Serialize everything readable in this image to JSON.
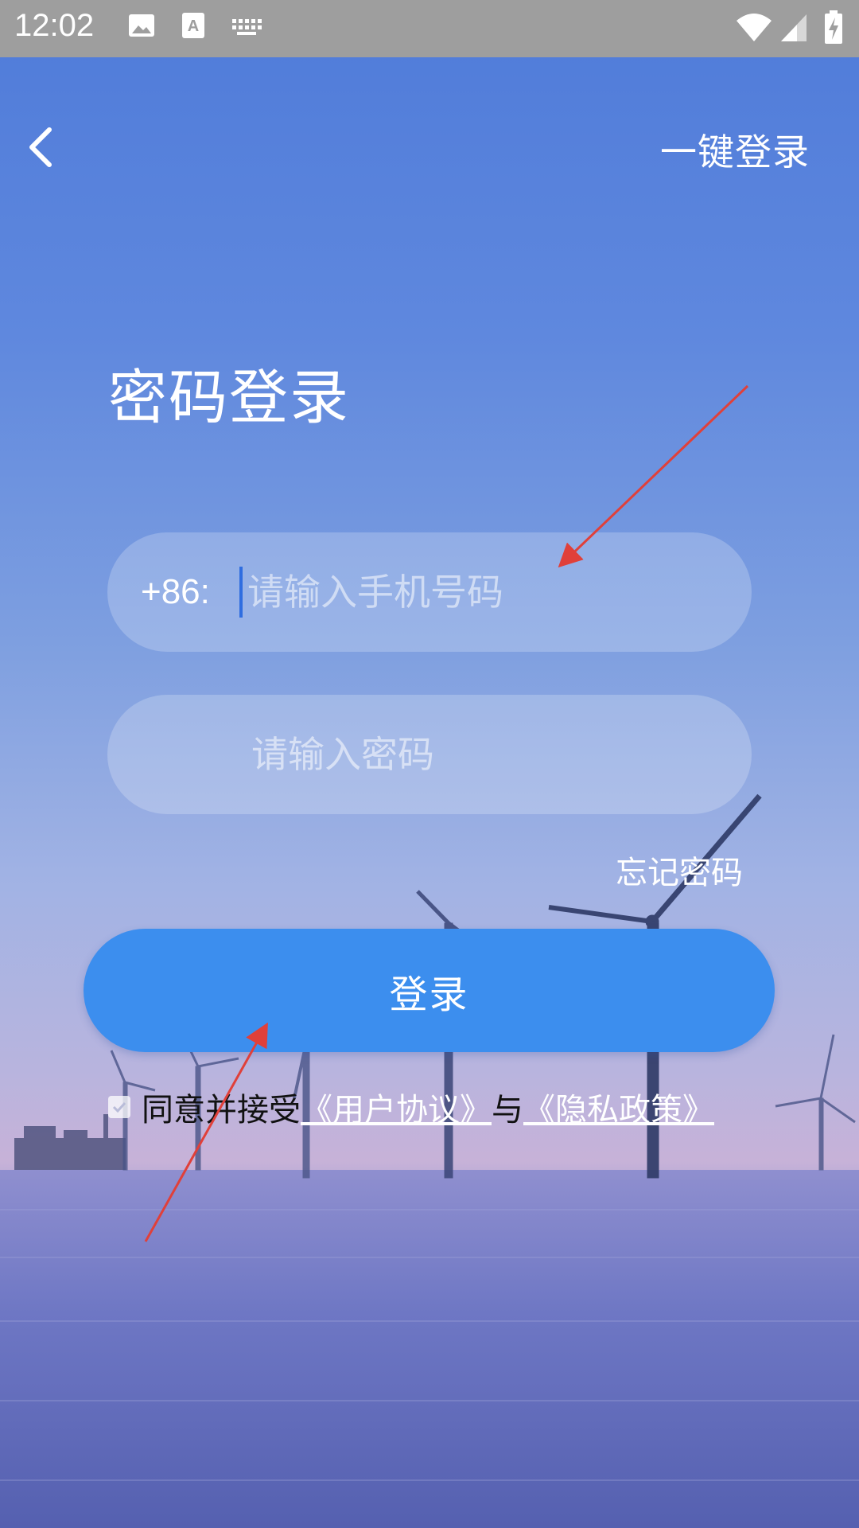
{
  "status_bar": {
    "time": "12:02",
    "icons": [
      "image-icon",
      "text-a-icon",
      "keyboard-icon",
      "wifi-icon",
      "signal-icon",
      "battery-charging-icon"
    ]
  },
  "header": {
    "back_icon": "chevron-left-icon",
    "one_key_login": "一键登录"
  },
  "title": "密码登录",
  "phone": {
    "prefix": "+86:",
    "placeholder": "请输入手机号码",
    "value": ""
  },
  "password": {
    "placeholder": "请输入密码",
    "value": ""
  },
  "forgot_password": "忘记密码",
  "login_button": "登录",
  "agreement": {
    "checked": true,
    "prefix": "同意并接受",
    "user_agreement": "《用户协议》",
    "conjunction": "与",
    "privacy_policy": "《隐私政策》"
  },
  "colors": {
    "accent": "#3c8eee",
    "annotation_arrow": "#e0403a"
  }
}
